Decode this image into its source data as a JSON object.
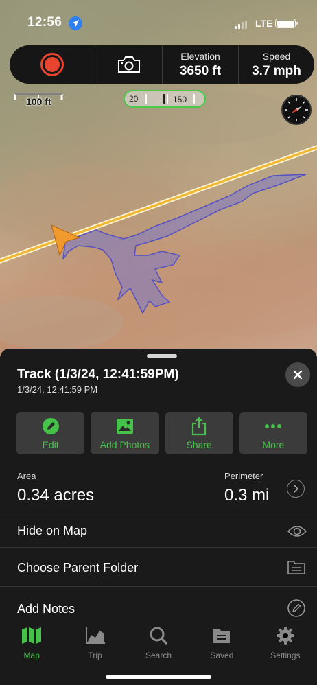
{
  "status_bar": {
    "time": "12:56",
    "network": "LTE",
    "signal_bars": 2,
    "signal_total": 4,
    "battery_level": 1.0
  },
  "toolbar": {
    "record_icon": "record-icon",
    "camera_icon": "camera-icon",
    "elevation_label": "Elevation",
    "elevation_value": "3650 ft",
    "speed_label": "Speed",
    "speed_value": "3.7 mph"
  },
  "map": {
    "scale_label": "100 ft",
    "ruler_low": "20",
    "ruler_high": "150",
    "track_color": "#7b78c9",
    "road_color": "#f2b735",
    "heading_color": "#f09a2e"
  },
  "sheet": {
    "title": "Track (1/3/24, 12:41:59PM)",
    "subtitle": "1/3/24, 12:41:59 PM",
    "actions": [
      {
        "label": "Edit",
        "icon": "pencil-icon"
      },
      {
        "label": "Add Photos",
        "icon": "photo-icon"
      },
      {
        "label": "Share",
        "icon": "share-icon"
      },
      {
        "label": "More",
        "icon": "more-icon"
      }
    ],
    "area_label": "Area",
    "area_value": "0.34 acres",
    "perimeter_label": "Perimeter",
    "perimeter_value": "0.3 mi",
    "rows": [
      {
        "label": "Hide on Map",
        "icon": "eye-icon"
      },
      {
        "label": "Choose Parent Folder",
        "icon": "folder-icon"
      },
      {
        "label": "Add Notes",
        "icon": "pencil-circle-icon"
      }
    ]
  },
  "tabs": [
    {
      "label": "Map",
      "icon": "map-icon",
      "active": true
    },
    {
      "label": "Trip",
      "icon": "trip-chart-icon",
      "active": false
    },
    {
      "label": "Search",
      "icon": "search-icon",
      "active": false
    },
    {
      "label": "Saved",
      "icon": "saved-folder-icon",
      "active": false
    },
    {
      "label": "Settings",
      "icon": "gear-icon",
      "active": false
    }
  ],
  "colors": {
    "accent_green": "#46c14a",
    "record_red": "#e8442f",
    "sheet_bg": "#1a1a1a",
    "button_bg": "#3b3b3b"
  }
}
